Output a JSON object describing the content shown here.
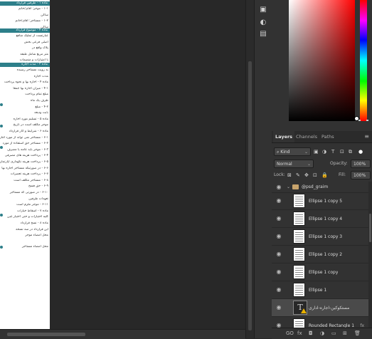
{
  "document": {
    "bars": [
      {
        "label": "ماده ۱ - طرفین قرارداد"
      },
      {
        "label": "ماده ۲ - موضوع قرارداد"
      },
      {
        "label": "ماده ۳ - مدت اجاره"
      }
    ],
    "lines": [
      "۱-۱ - موجر: آقای/خانم",
      "ساکن",
      "۱-۲ - مستاجر: آقای/خانم",
      "ساکن",
      "عبارتست از تملیک منافع",
      "اصلی فرعی بخش",
      "پلاک واقع در",
      "متر مربع شامل طبقه",
      "با امتیازات و منضمات",
      "به رویت مستاجر رسیده",
      "مدت اجاره",
      "ماده ۴ - اجاره بها و نحوه پرداخت",
      "۴-۱ - میزان اجاره بها جمعاً",
      "مبلغ تمام پرداخت",
      "ظرف یک ماه",
      "۴-۲ - مبلغ",
      "بابت ودیعه",
      "ماده ۵ - تسلیم مورد اجاره",
      "موجر مکلف است در تاریخ",
      "ماده ۶ - شرایط و آثار قرارداد",
      "۶-۱ - مستاجر نمی تواند از مورد اجاره",
      "۶-۲ - مستاجر حق استفاده از مورد",
      "۶-۳ - موجر باید عامه یا مصرف",
      "۶-۴ - پرداخت هزینه های مصرفی",
      "۶-۵ - پرداخت هزینه نگهداری آپارتمان",
      "۶-۶ - در صورتیکه مستاجر اجاره بها",
      "۶-۷ - پرداخت هزینه تعمیرات",
      "۶-۸ - مستاجر مکلف است",
      "۶-۹ - حق فسخ",
      "۶-۱۰ - در صورتی که مستاجر",
      "تعهدات طرفین",
      "۶-۱۱ - موجر ملزم است",
      "ماده ۷ - اسقاط خیارات",
      "کلیه اختیارات و حتی اختیار غبن",
      "ماده ۸ - نسخ قرارداد",
      "این قرارداد در سه نسخه",
      "محل امضاء موجر",
      "محل امضاء مستاجر"
    ]
  },
  "mini_panel": {
    "icons": [
      "history-icon",
      "adjustments-icon",
      "properties-icon"
    ]
  },
  "layers_panel": {
    "tabs": [
      "Layers",
      "Channels",
      "Paths"
    ],
    "active_tab": "Layers",
    "filter_kind": "Kind",
    "blend_mode": "Normal",
    "opacity_label": "Opacity:",
    "opacity_value": "100%",
    "lock_label": "Lock:",
    "fill_label": "Fill:",
    "fill_value": "100%",
    "group_name": "@psd_graim",
    "layers": [
      {
        "name": "Ellipse 1 copy 5",
        "kind": "shape"
      },
      {
        "name": "Ellipse 1 copy 4",
        "kind": "shape"
      },
      {
        "name": "Ellipse 1 copy 3",
        "kind": "shape"
      },
      {
        "name": "Ellipse 1 copy 2",
        "kind": "shape"
      },
      {
        "name": "Ellipse 1 copy",
        "kind": "shape"
      },
      {
        "name": "Ellipse 1",
        "kind": "shape"
      },
      {
        "name": "مستکوکین-اجاره-اداری",
        "kind": "text"
      },
      {
        "name": "Rounded Rectangle 1",
        "kind": "shape",
        "fx": "fx"
      }
    ],
    "bottom_icons": [
      "link-icon",
      "fx-icon",
      "mask-icon",
      "adjustment-icon",
      "folder-icon",
      "new-layer-icon",
      "trash-icon"
    ],
    "bottom_labels": [
      "GO",
      "fx",
      "◘",
      "◑",
      "▭",
      "⊞",
      "🗑"
    ]
  }
}
